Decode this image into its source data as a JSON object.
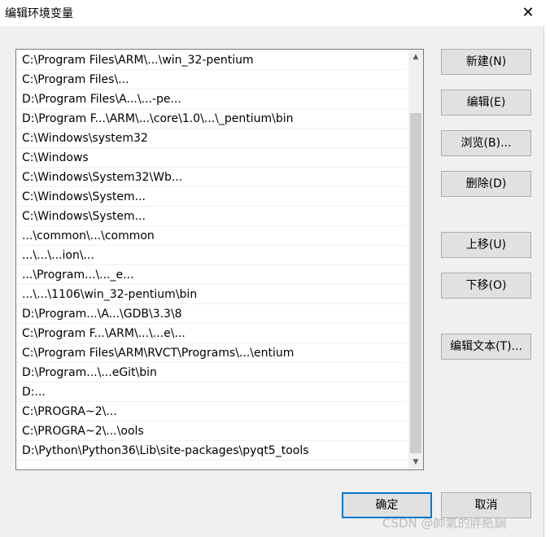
{
  "window": {
    "title": "编辑环境变量",
    "close_glyph": "✕"
  },
  "list": {
    "items": [
      "C:\\Program Files\\ARM\\...\\win_32-pentium",
      "C:\\Program Files\\...",
      "D:\\Program Files\\A...\\...-pe...",
      "D:\\Program F...\\ARM\\...\\core\\1.0\\...\\_pentium\\bin",
      "C:\\Windows\\system32",
      "C:\\Windows",
      "C:\\Windows\\System32\\Wb...",
      "C:\\Windows\\System...",
      "C:\\Windows\\System...",
      "...\\common\\...\\common",
      "...\\...\\...ion\\...",
      "...\\Program...\\..._e...",
      "...\\...\\1106\\win_32-pentium\\bin",
      "D:\\Program...\\A...\\GDB\\3.3\\8",
      "C:\\Program F...\\ARM\\...\\...e\\...",
      "C:\\Program Files\\ARM\\RVCT\\Programs\\...\\entium",
      "D:\\Program...\\...eGit\\bin",
      "D:...",
      "C:\\PROGRA~2\\...",
      "C:\\PROGRA~2\\...\\ools",
      "D:\\Python\\Python36\\Lib\\site-packages\\pyqt5_tools"
    ],
    "scroll_up": "▲",
    "scroll_down": "▼"
  },
  "buttons": {
    "new": "新建(N)",
    "edit": "编辑(E)",
    "browse": "浏览(B)...",
    "delete": "删除(D)",
    "move_up": "上移(U)",
    "move_down": "下移(O)",
    "edit_text": "编辑文本(T)...",
    "ok": "确定",
    "cancel": "取消"
  },
  "watermark": "CSDN @帥氣的胖紙鍋"
}
